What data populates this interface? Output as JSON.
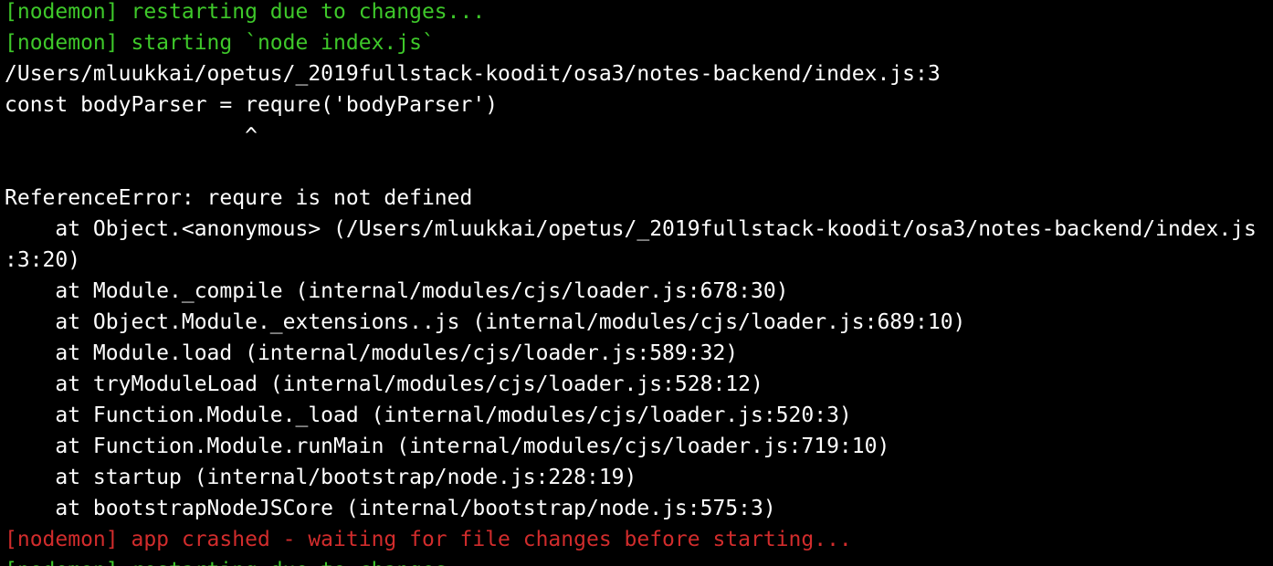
{
  "colors": {
    "background": "#000000",
    "text": "#ffffff",
    "nodemon_info": "#3ec82a",
    "nodemon_error": "#d12c2c"
  },
  "terminal": {
    "lines": [
      "[nodemon] restarting due to changes...",
      "[nodemon] starting `node index.js`",
      "/Users/mluukkai/opetus/_2019fullstack-koodit/osa3/notes-backend/index.js:3",
      "const bodyParser = requre('bodyParser')",
      "                   ^",
      "",
      "ReferenceError: requre is not defined",
      "    at Object.<anonymous> (/Users/mluukkai/opetus/_2019fullstack-koodit/osa3/notes-backend/index.js",
      ":3:20)",
      "    at Module._compile (internal/modules/cjs/loader.js:678:30)",
      "    at Object.Module._extensions..js (internal/modules/cjs/loader.js:689:10)",
      "    at Module.load (internal/modules/cjs/loader.js:589:32)",
      "    at tryModuleLoad (internal/modules/cjs/loader.js:528:12)",
      "    at Function.Module._load (internal/modules/cjs/loader.js:520:3)",
      "    at Function.Module.runMain (internal/modules/cjs/loader.js:719:10)",
      "    at startup (internal/bootstrap/node.js:228:19)",
      "    at bootstrapNodeJSCore (internal/bootstrap/node.js:575:3)",
      "[nodemon] app crashed - waiting for file changes before starting...",
      "[nodemon] restarting due to changes..."
    ]
  }
}
